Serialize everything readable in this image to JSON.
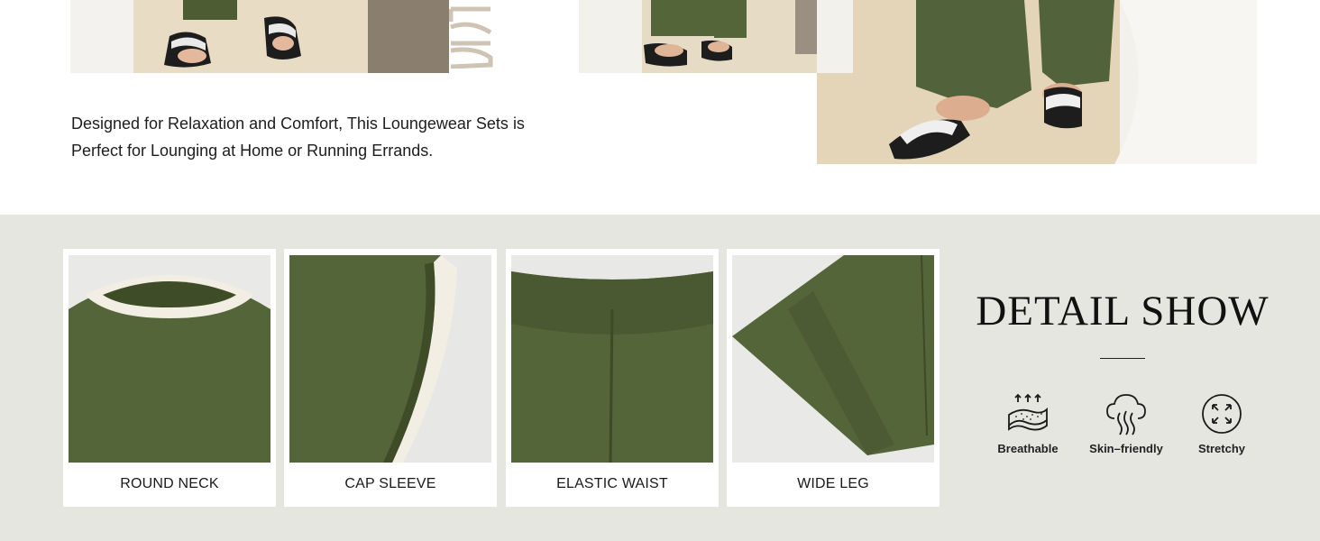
{
  "intro": {
    "line1": "Designed for Relaxation and Comfort, This Loungewear Sets is",
    "line2": "Perfect for Lounging at Home or Running Errands."
  },
  "details": {
    "title": "DETAIL SHOW",
    "cards": [
      {
        "caption": "ROUND NECK"
      },
      {
        "caption": "CAP SLEEVE"
      },
      {
        "caption": "ELASTIC WAIST"
      },
      {
        "caption": "WIDE LEG"
      }
    ],
    "features": [
      {
        "label": "Breathable",
        "icon": "breathable-icon"
      },
      {
        "label": "Skin–friendly",
        "icon": "skin-friendly-icon"
      },
      {
        "label": "Stretchy",
        "icon": "stretchy-icon"
      }
    ]
  },
  "colors": {
    "fabric_green": "#5a6a3c",
    "panel_bg": "#e6e6e1",
    "trim_cream": "#f1ede2"
  }
}
